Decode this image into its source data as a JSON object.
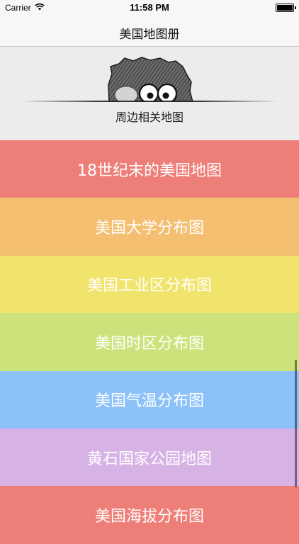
{
  "status_bar": {
    "carrier": "Carrier",
    "wifi_icon": "wifi-icon",
    "time": "11:58 PM",
    "battery_icon": "battery-icon"
  },
  "nav": {
    "title": "美国地图册"
  },
  "header": {
    "caption": "周边相关地图",
    "image_icon": "peeking-creature"
  },
  "list": {
    "items": [
      {
        "label": "18世纪末的美国地图",
        "color": "#ee7f78"
      },
      {
        "label": "美国大学分布图",
        "color": "#f4bf71"
      },
      {
        "label": "美国工业区分布图",
        "color": "#f1e46d"
      },
      {
        "label": "美国时区分布图",
        "color": "#cce37c"
      },
      {
        "label": "美国气温分布图",
        "color": "#8cc1f9"
      },
      {
        "label": "黄石国家公园地图",
        "color": "#d7b3e5"
      },
      {
        "label": "美国海拔分布图",
        "color": "#ee7f78"
      }
    ]
  }
}
